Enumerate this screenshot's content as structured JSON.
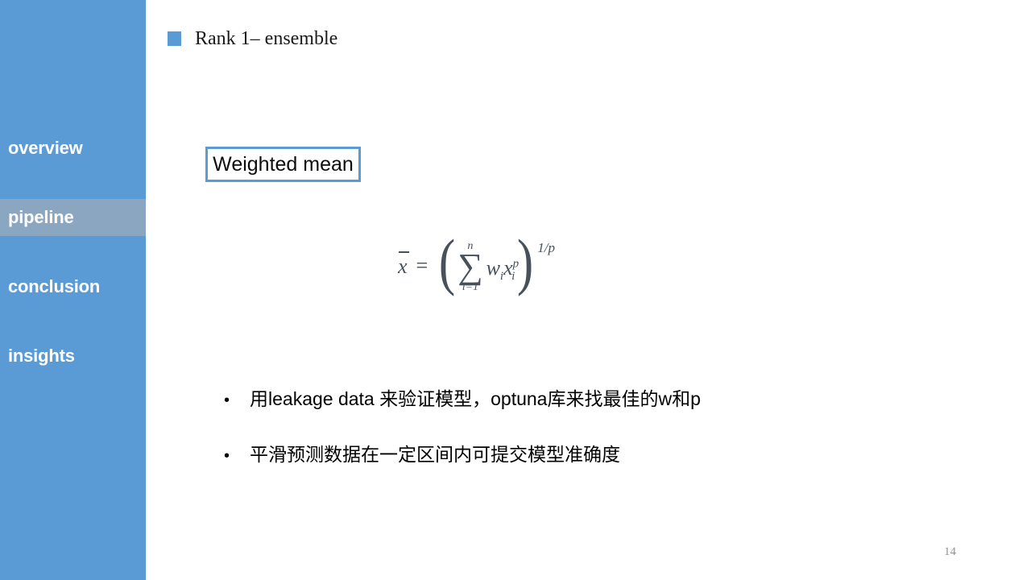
{
  "slide": {
    "page_number": "14",
    "background_color": "#ffffff"
  },
  "sidebar": {
    "background_color": "#5b9bd5",
    "active_background_color": "#8aa6c0",
    "items": [
      {
        "label": "overview",
        "active": false
      },
      {
        "label": "pipeline",
        "active": true
      },
      {
        "label": "conclusion",
        "active": false
      },
      {
        "label": "insights",
        "active": false
      }
    ]
  },
  "header": {
    "marker_color": "#5b9bd5",
    "title": "Rank 1– ensemble"
  },
  "content": {
    "label_box": {
      "text": "Weighted mean",
      "border_color": "#5b9bd5"
    },
    "formula": {
      "plain": "x̄ = ( Σ(i=1..n) w_i x_i^p )^(1/p)",
      "lhs_variable": "x",
      "equals": "=",
      "sum_upper_limit": "n",
      "sum_symbol": "∑",
      "sum_lower_limit": "i=1",
      "weight_symbol": "w",
      "weight_index": "i",
      "value_symbol": "x",
      "value_index": "i",
      "value_power": "p",
      "outer_exponent": "1/p",
      "color": "#47515c"
    },
    "bullets": [
      {
        "marker": "•",
        "text": "用leakage data 来验证模型，optuna库来找最佳的w和p"
      },
      {
        "marker": "•",
        "text": "平滑预测数据在一定区间内可提交模型准确度"
      }
    ]
  }
}
